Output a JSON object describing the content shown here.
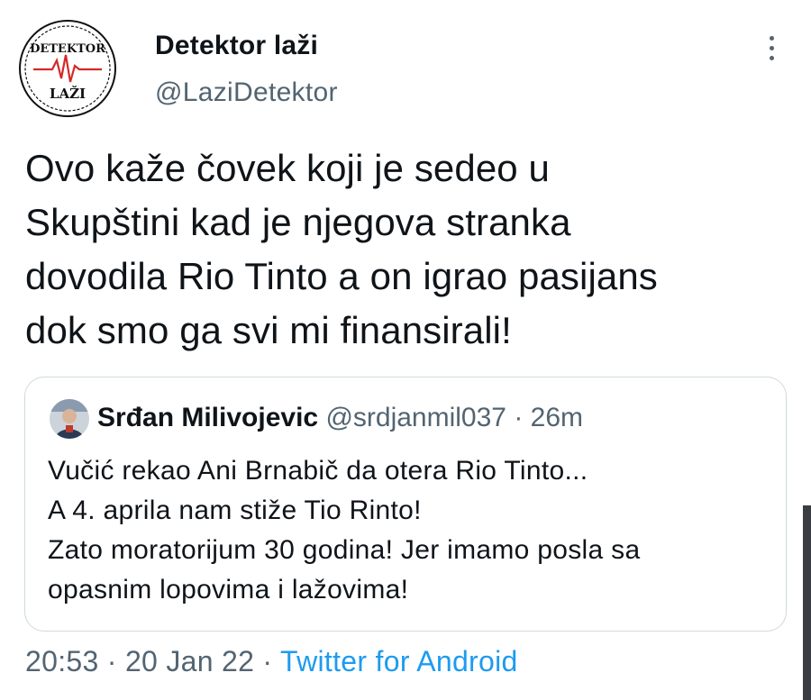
{
  "author": {
    "display_name": "Detektor laži",
    "handle": "@LaziDetektor",
    "avatar_text_top": "DETEKTOR",
    "avatar_text_bottom": "LAŽI",
    "avatar_icon": "heartbeat-line-icon"
  },
  "tweet": {
    "lines": [
      "Ovo kaže čovek koji je sedeo u",
      "Skupštini kad je njegova stranka",
      "dovodila Rio Tinto a on igrao pasijans",
      "dok smo ga svi mi finansirali!"
    ]
  },
  "quoted_tweet": {
    "display_name": "Srđan Milivojevic",
    "handle": "@srdjanmil037",
    "separator": "·",
    "time": "26m",
    "lines": [
      "Vučić rekao Ani Brnabič da otera Rio Tinto...",
      "A 4. aprila nam stiže Tio Rinto!",
      "Zato moratorijum 30 godina! Jer imamo posla sa",
      "opasnim lopovima i lažovima!"
    ]
  },
  "footer": {
    "time": "20:53",
    "separator": "·",
    "date": "20 Jan 22",
    "source": "Twitter for Android"
  },
  "icons": {
    "more": "more-vertical-icon"
  },
  "colors": {
    "text": "#0f1419",
    "secondary": "#536471",
    "link": "#1d9bf0",
    "border": "#cfd9de",
    "avatar_pulse": "#d62828"
  }
}
